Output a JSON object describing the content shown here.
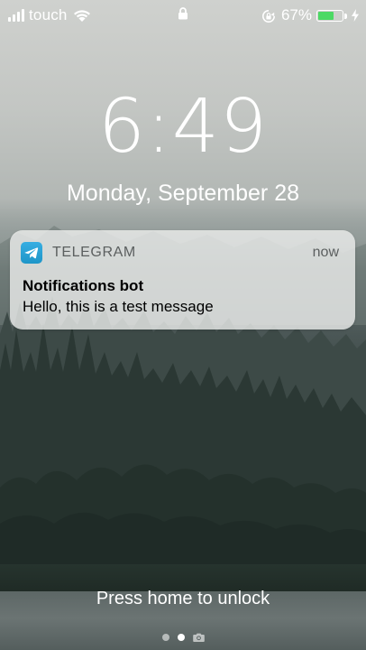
{
  "status_bar": {
    "carrier": "touch",
    "battery_percent": "67%",
    "battery_level": 0.67,
    "icons": [
      "signal-icon",
      "wifi-icon",
      "lock-icon",
      "rotation-lock-icon",
      "battery-icon",
      "charging-bolt-icon"
    ]
  },
  "lock_screen": {
    "time": "6:49",
    "date": "Monday, September 28"
  },
  "notification": {
    "app_name": "TELEGRAM",
    "time": "now",
    "title": "Notifications bot",
    "body": "Hello, this is a test message",
    "app_color": "#2ca5e0"
  },
  "bottom": {
    "unlock_text": "Press home to unlock",
    "pages": [
      "dot",
      "dot-active",
      "camera-icon"
    ]
  },
  "colors": {
    "battery_fill": "#4cd964",
    "telegram_blue": "#2ca5e0"
  }
}
